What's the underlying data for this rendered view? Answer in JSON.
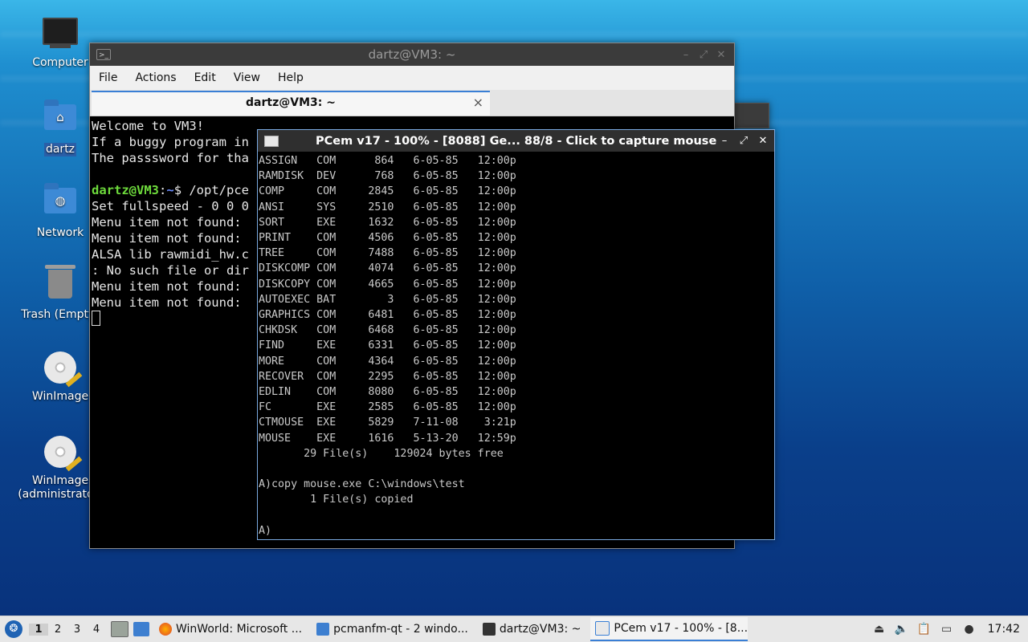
{
  "desktop": {
    "icons": [
      {
        "label": "Computer"
      },
      {
        "label": "dartz"
      },
      {
        "label": "Network"
      },
      {
        "label": "Trash (Empty)"
      },
      {
        "label": "WinImage"
      },
      {
        "label": "WinImage\n(administrator)"
      }
    ]
  },
  "terminal": {
    "title": "dartz@VM3: ~",
    "menu": [
      "File",
      "Actions",
      "Edit",
      "View",
      "Help"
    ],
    "tab_title": "dartz@VM3: ~",
    "tab_close": "×",
    "lines": [
      "Welcome to VM3!",
      "If a buggy program in",
      "The passsword for tha",
      "",
      "",
      "Set fullspeed - 0 0 0",
      "Menu item not found: ",
      "Menu item not found: ",
      "ALSA lib rawmidi_hw.c",
      ": No such file or dir",
      "Menu item not found: ",
      "Menu item not found: "
    ],
    "prompt_user": "dartz@VM3",
    "prompt_sep": ":",
    "prompt_path": "~",
    "prompt_cmd": "$ /opt/pce"
  },
  "pcem": {
    "title": "PCem v17 - 100% - [8088] Ge... 88/8 - Click to capture mouse",
    "lines": [
      "ASSIGN   COM      864   6-05-85   12:00p",
      "RAMDISK  DEV      768   6-05-85   12:00p",
      "COMP     COM     2845   6-05-85   12:00p",
      "ANSI     SYS     2510   6-05-85   12:00p",
      "SORT     EXE     1632   6-05-85   12:00p",
      "PRINT    COM     4506   6-05-85   12:00p",
      "TREE     COM     7488   6-05-85   12:00p",
      "DISKCOMP COM     4074   6-05-85   12:00p",
      "DISKCOPY COM     4665   6-05-85   12:00p",
      "AUTOEXEC BAT        3   6-05-85   12:00p",
      "GRAPHICS COM     6481   6-05-85   12:00p",
      "CHKDSK   COM     6468   6-05-85   12:00p",
      "FIND     EXE     6331   6-05-85   12:00p",
      "MORE     COM     4364   6-05-85   12:00p",
      "RECOVER  COM     2295   6-05-85   12:00p",
      "EDLIN    COM     8080   6-05-85   12:00p",
      "FC       EXE     2585   6-05-85   12:00p",
      "CTMOUSE  EXE     5829   7-11-08    3:21p",
      "MOUSE    EXE     1616   5-13-20   12:59p",
      "       29 File(s)    129024 bytes free",
      "",
      "A)copy mouse.exe C:\\windows\\test",
      "        1 File(s) copied",
      "",
      "A)"
    ]
  },
  "taskbar": {
    "workspaces": [
      "1",
      "2",
      "3",
      "4"
    ],
    "tasks": [
      {
        "label": "WinWorld: Microsoft ..."
      },
      {
        "label": "pcmanfm-qt - 2 windo..."
      },
      {
        "label": "dartz@VM3: ~"
      },
      {
        "label": "PCem v17 - 100% - [8..."
      }
    ],
    "clock": "17:42"
  }
}
